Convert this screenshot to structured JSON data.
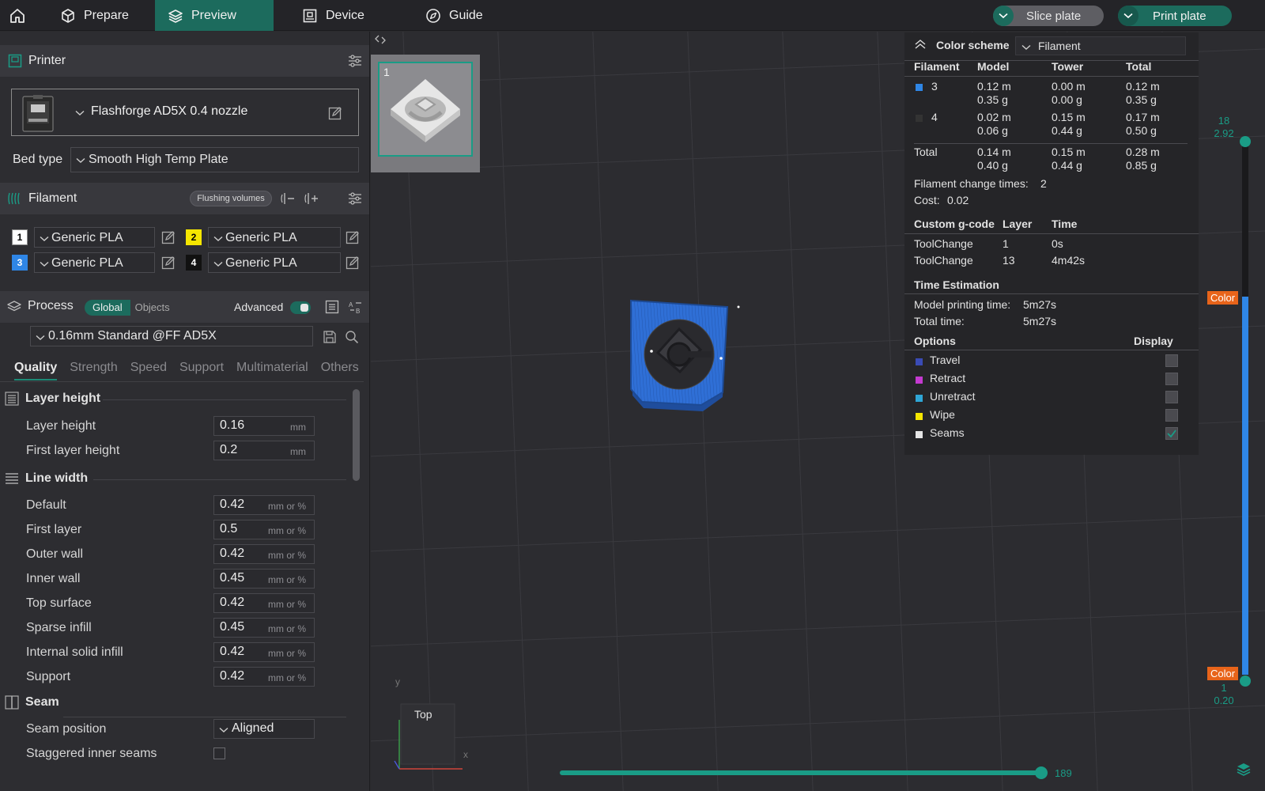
{
  "topbar": {
    "tabs": {
      "prepare": "Prepare",
      "preview": "Preview",
      "device": "Device",
      "guide": "Guide"
    },
    "slice_label": "Slice plate",
    "print_label": "Print plate"
  },
  "printer": {
    "title": "Printer",
    "name": "Flashforge AD5X 0.4 nozzle",
    "bed_type_label": "Bed type",
    "bed_type_value": "Smooth High Temp Plate"
  },
  "filament": {
    "title": "Filament",
    "flushing_label": "Flushing volumes",
    "items": [
      {
        "num": "1",
        "name": "Generic PLA",
        "color": "#ffffff",
        "text_color": "#000000"
      },
      {
        "num": "2",
        "name": "Generic PLA",
        "color": "#f5e600",
        "text_color": "#000000"
      },
      {
        "num": "3",
        "name": "Generic PLA",
        "color": "#2f86e6",
        "text_color": "#ffffff"
      },
      {
        "num": "4",
        "name": "Generic PLA",
        "color": "#111111",
        "text_color": "#ffffff"
      }
    ]
  },
  "process": {
    "title": "Process",
    "global_label": "Global",
    "objects_label": "Objects",
    "advanced_label": "Advanced",
    "advanced_on": true,
    "profile": "0.16mm Standard @FF AD5X",
    "tabs": [
      "Quality",
      "Strength",
      "Speed",
      "Support",
      "Multimaterial",
      "Others"
    ]
  },
  "quality": {
    "layer_height_group": "Layer height",
    "layer_height_label": "Layer height",
    "layer_height_value": "0.16",
    "first_layer_height_label": "First layer height",
    "first_layer_height_value": "0.2",
    "unit_mm": "mm",
    "unit_mm_pct": "mm or %",
    "line_width_group": "Line width",
    "line_widths": [
      {
        "label": "Default",
        "value": "0.42"
      },
      {
        "label": "First layer",
        "value": "0.5"
      },
      {
        "label": "Outer wall",
        "value": "0.42"
      },
      {
        "label": "Inner wall",
        "value": "0.45"
      },
      {
        "label": "Top surface",
        "value": "0.42"
      },
      {
        "label": "Sparse infill",
        "value": "0.45"
      },
      {
        "label": "Internal solid infill",
        "value": "0.42"
      },
      {
        "label": "Support",
        "value": "0.42"
      }
    ],
    "seam_group": "Seam",
    "seam_position_label": "Seam position",
    "seam_position_value": "Aligned",
    "staggered_label": "Staggered inner seams",
    "staggered_checked": false
  },
  "viewport": {
    "plate_number": "1",
    "view_cube_label": "Top",
    "axis_x": "x",
    "axis_y": "y",
    "accent_color": "#1a9c86",
    "model_color": "#2f6fd6"
  },
  "stats": {
    "color_scheme_label": "Color scheme",
    "color_scheme_value": "Filament",
    "headers": {
      "filament": "Filament",
      "model": "Model",
      "tower": "Tower",
      "total": "Total"
    },
    "rows": [
      {
        "id": "3",
        "color": "#2f86e6",
        "model_m": "0.12 m",
        "model_g": "0.35 g",
        "tower_m": "0.00 m",
        "tower_g": "0.00 g",
        "total_m": "0.12 m",
        "total_g": "0.35 g"
      },
      {
        "id": "4",
        "color": "#333333",
        "model_m": "0.02 m",
        "model_g": "0.06 g",
        "tower_m": "0.15 m",
        "tower_g": "0.44 g",
        "total_m": "0.17 m",
        "total_g": "0.50 g"
      }
    ],
    "total_row": {
      "label": "Total",
      "model_m": "0.14 m",
      "model_g": "0.40 g",
      "tower_m": "0.15 m",
      "tower_g": "0.44 g",
      "total_m": "0.28 m",
      "total_g": "0.85 g"
    },
    "change_times_label": "Filament change times:",
    "change_times_value": "2",
    "cost_label": "Cost:",
    "cost_value": "0.02",
    "gcode_headers": {
      "custom": "Custom g-code",
      "layer": "Layer",
      "time": "Time"
    },
    "gcode_rows": [
      {
        "name": "ToolChange",
        "layer": "1",
        "time": "0s"
      },
      {
        "name": "ToolChange",
        "layer": "13",
        "time": "4m42s"
      }
    ],
    "time_estimation_label": "Time Estimation",
    "model_time_label": "Model printing time:",
    "model_time_value": "5m27s",
    "total_time_label": "Total time:",
    "total_time_value": "5m27s",
    "options_label": "Options",
    "display_label": "Display",
    "options": [
      {
        "name": "Travel",
        "color": "#3a4bb5",
        "checked": false
      },
      {
        "name": "Retract",
        "color": "#c43ad0",
        "checked": false
      },
      {
        "name": "Unretract",
        "color": "#2fa6d6",
        "checked": false
      },
      {
        "name": "Wipe",
        "color": "#f5e600",
        "checked": false
      },
      {
        "name": "Seams",
        "color": "#e6e6e6",
        "checked": true
      }
    ]
  },
  "layer_slider": {
    "top_layer": "18",
    "top_height": "2.92",
    "bottom_layer": "1",
    "bottom_height": "0.20",
    "color_tag": "Color",
    "move_value": "189"
  }
}
